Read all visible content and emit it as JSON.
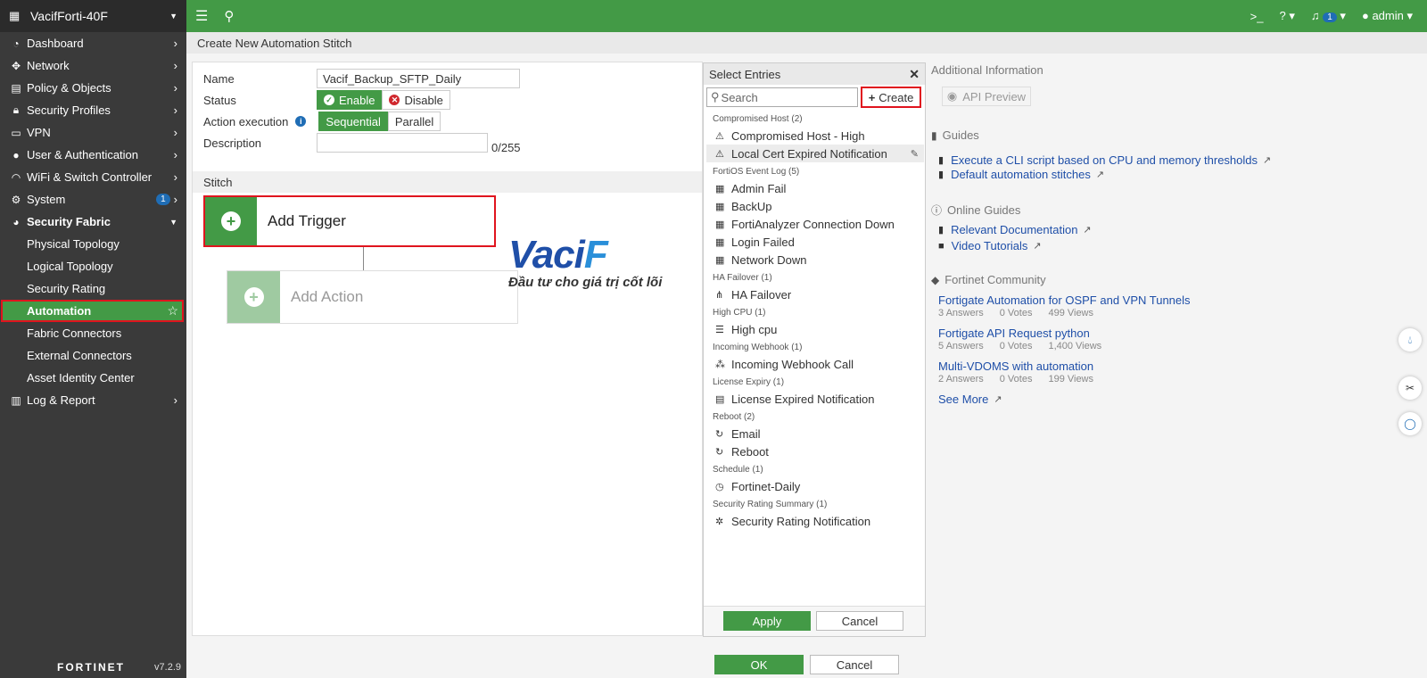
{
  "device": {
    "name": "VacifForti-40F",
    "version": "v7.2.9",
    "brand": "FORTINET"
  },
  "sidebar": {
    "items": [
      {
        "label": "Dashboard",
        "icon": "dashboard-icon"
      },
      {
        "label": "Network",
        "icon": "network-icon"
      },
      {
        "label": "Policy & Objects",
        "icon": "policy-icon"
      },
      {
        "label": "Security Profiles",
        "icon": "lock-icon"
      },
      {
        "label": "VPN",
        "icon": "vpn-icon"
      },
      {
        "label": "User & Authentication",
        "icon": "user-icon"
      },
      {
        "label": "WiFi & Switch Controller",
        "icon": "wifi-icon"
      },
      {
        "label": "System",
        "icon": "gear-icon",
        "badge": "1"
      },
      {
        "label": "Security Fabric",
        "icon": "fabric-icon"
      }
    ],
    "sub": [
      "Physical Topology",
      "Logical Topology",
      "Security Rating",
      "Automation",
      "Fabric Connectors",
      "External Connectors",
      "Asset Identity Center"
    ],
    "last": {
      "label": "Log & Report",
      "icon": "chart-icon"
    }
  },
  "topbar": {
    "user": "admin",
    "notif": "1"
  },
  "page": {
    "title": "Create New Automation Stitch"
  },
  "form": {
    "name_label": "Name",
    "name_value": "Vacif_Backup_SFTP_Daily",
    "status_label": "Status",
    "enable": "Enable",
    "disable": "Disable",
    "exec_label": "Action execution",
    "sequential": "Sequential",
    "parallel": "Parallel",
    "desc_label": "Description",
    "desc_count": "0/255",
    "stitch_label": "Stitch",
    "add_trigger": "Add Trigger",
    "add_action": "Add Action"
  },
  "watermark": {
    "name_a": "Vaci",
    "name_b": "F",
    "slogan": "Đầu tư cho giá trị cốt lõi"
  },
  "select": {
    "title": "Select Entries",
    "search": "Search",
    "create": "Create",
    "groups": [
      {
        "name": "Compromised Host (2)",
        "entries": [
          [
            "⚠",
            "Compromised Host - High"
          ],
          [
            "⚠",
            "Local Cert Expired Notification"
          ]
        ]
      },
      {
        "name": "FortiOS Event Log (5)",
        "entries": [
          [
            "▦",
            "Admin Fail"
          ],
          [
            "▦",
            "BackUp"
          ],
          [
            "▦",
            "FortiAnalyzer Connection Down"
          ],
          [
            "▦",
            "Login Failed"
          ],
          [
            "▦",
            "Network Down"
          ]
        ]
      },
      {
        "name": "HA Failover (1)",
        "entries": [
          [
            "⋔",
            "HA Failover"
          ]
        ]
      },
      {
        "name": "High CPU (1)",
        "entries": [
          [
            "☰",
            "High cpu"
          ]
        ]
      },
      {
        "name": "Incoming Webhook (1)",
        "entries": [
          [
            "⁂",
            "Incoming Webhook Call"
          ]
        ]
      },
      {
        "name": "License Expiry (1)",
        "entries": [
          [
            "▤",
            "License Expired Notification"
          ]
        ]
      },
      {
        "name": "Reboot (2)",
        "entries": [
          [
            "↻",
            "Email"
          ],
          [
            "↻",
            "Reboot"
          ]
        ]
      },
      {
        "name": "Schedule (1)",
        "entries": [
          [
            "◷",
            "Fortinet-Daily"
          ]
        ]
      },
      {
        "name": "Security Rating Summary (1)",
        "entries": [
          [
            "✲",
            "Security Rating Notification"
          ]
        ]
      }
    ],
    "apply": "Apply",
    "cancel": "Cancel"
  },
  "footer": {
    "ok": "OK",
    "cancel": "Cancel"
  },
  "info": {
    "title": "Additional Information",
    "api": "API Preview",
    "guides_title": "Guides",
    "guides": [
      "Execute a CLI script based on CPU and memory thresholds",
      "Default automation stitches"
    ],
    "online_title": "Online Guides",
    "online": [
      "Relevant Documentation",
      "Video Tutorials"
    ],
    "community_title": "Fortinet Community",
    "community": [
      {
        "title": "Fortigate Automation for OSPF and VPN Tunnels",
        "answers": "3 Answers",
        "votes": "0 Votes",
        "views": "499 Views"
      },
      {
        "title": "Fortigate API Request python",
        "answers": "5 Answers",
        "votes": "0 Votes",
        "views": "1,400 Views"
      },
      {
        "title": "Multi-VDOMS with automation",
        "answers": "2 Answers",
        "votes": "0 Votes",
        "views": "199 Views"
      }
    ],
    "see_more": "See More"
  }
}
